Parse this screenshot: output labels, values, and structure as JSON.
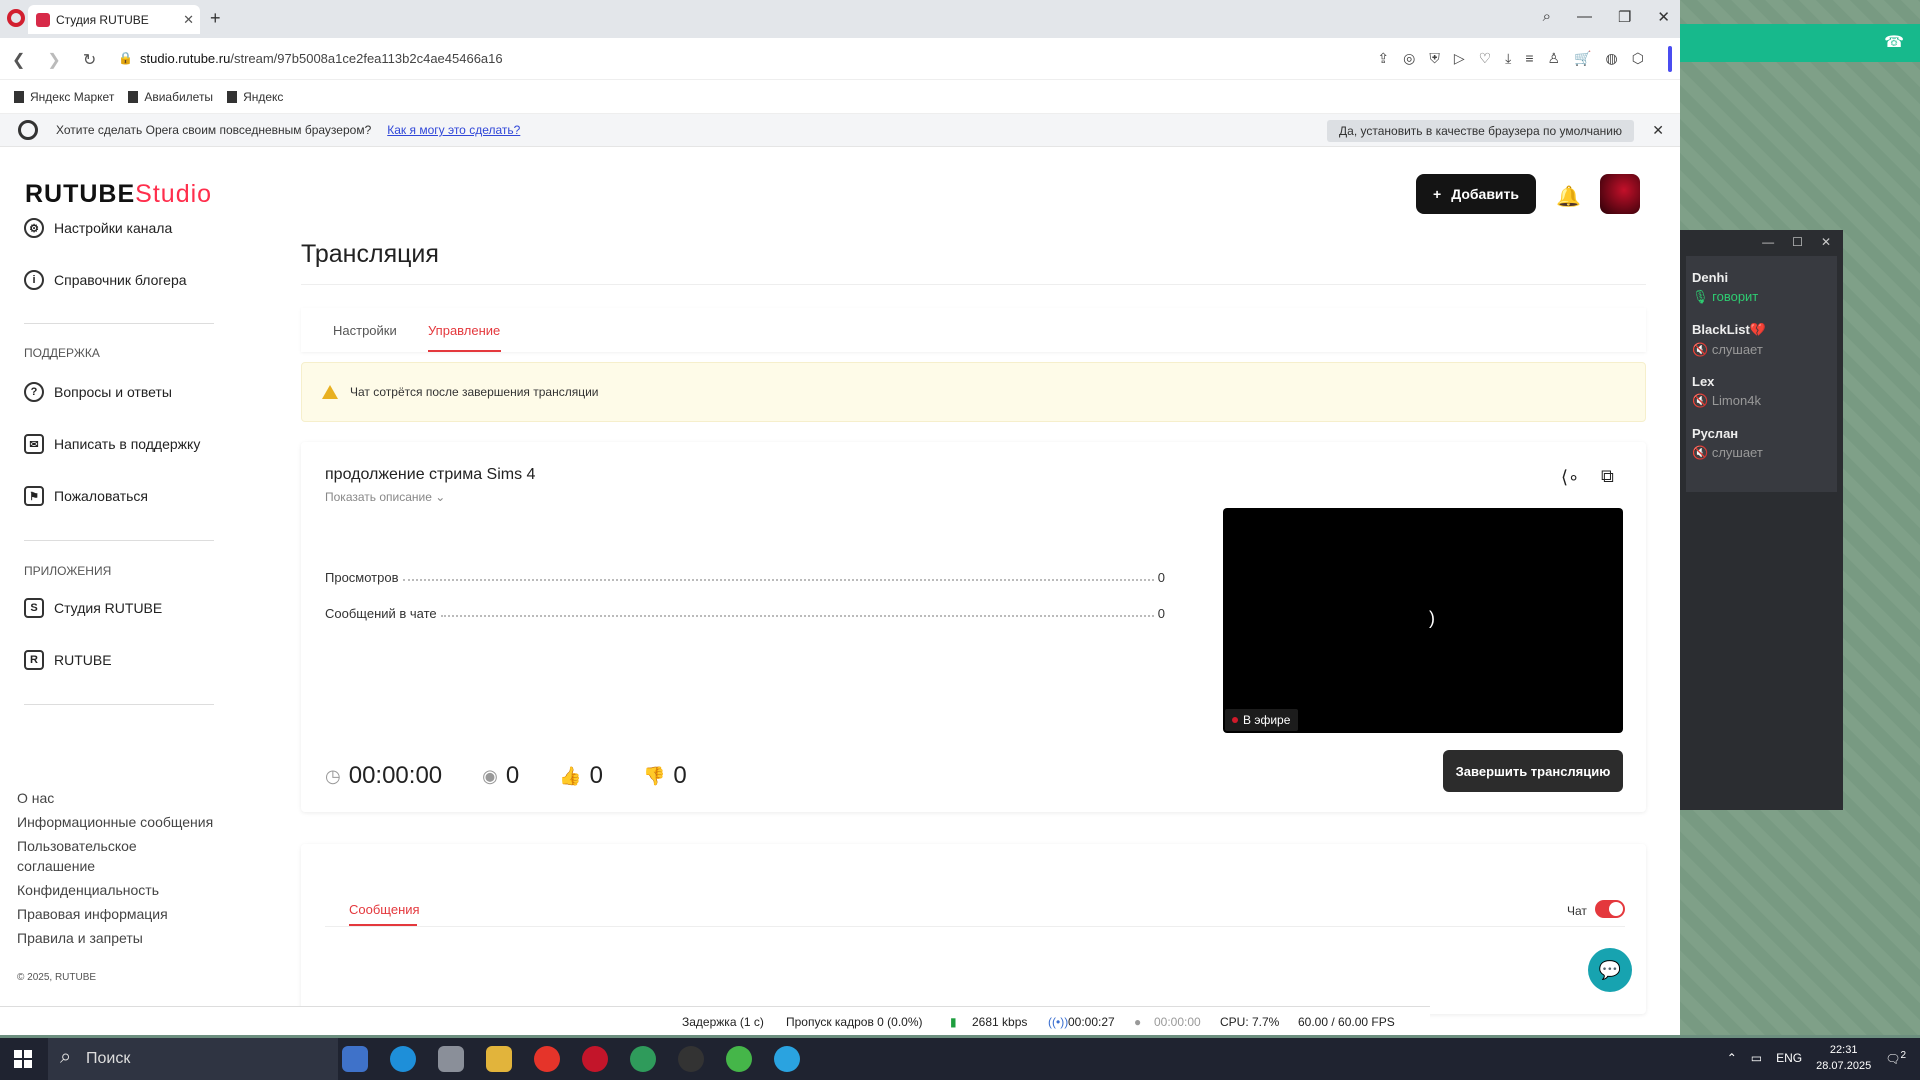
{
  "browser": {
    "tab_title": "Студия RUTUBE",
    "url_host": "studio.rutube.ru",
    "url_path": "/stream/97b5008a1ce2fea113b2c4ae45466a16",
    "bookmarks": [
      "Яндекс Маркет",
      "Авиабилеты",
      "Яндекс"
    ],
    "default_prompt": "Хотите сделать Opera своим повседневным браузером?",
    "default_link": "Как я могу это сделать?",
    "default_button": "Да, установить в качестве браузера по умолчанию"
  },
  "header": {
    "logo_main": "RUTUBE",
    "logo_studio": "Studio",
    "add_button": "Добавить"
  },
  "sidebar": {
    "items": [
      {
        "label": "Настройки канала"
      },
      {
        "label": "Справочник блогера"
      }
    ],
    "support_title": "ПОДДЕРЖКА",
    "support_items": [
      {
        "label": "Вопросы и ответы"
      },
      {
        "label": "Написать в поддержку"
      },
      {
        "label": "Пожаловаться"
      }
    ],
    "apps_title": "ПРИЛОЖЕНИЯ",
    "apps_items": [
      {
        "label": "Студия RUTUBE"
      },
      {
        "label": "RUTUBE"
      }
    ],
    "footer_links": [
      "О нас",
      "Информационные сообщения",
      "Пользовательское соглашение",
      "Конфиденциальность",
      "Правовая информация",
      "Правила и запреты"
    ],
    "copyright": "© 2025, RUTUBE"
  },
  "main": {
    "title": "Трансляция",
    "tabs": [
      {
        "label": "Настройки"
      },
      {
        "label": "Управление"
      }
    ],
    "active_tab": "Управление",
    "warning": "Чат сотрётся после завершения трансляции",
    "stream": {
      "title": "продолжение стрима Sims 4",
      "show_description": "Показать описание",
      "stats": [
        {
          "label": "Просмотров",
          "value": "0"
        },
        {
          "label": "Сообщений в чате",
          "value": "0"
        }
      ],
      "live_badge": "В эфире",
      "player_glyph": ")",
      "duration": "00:00:00",
      "viewers": "0",
      "likes": "0",
      "dislikes": "0",
      "end_button": "Завершить трансляцию"
    },
    "messages_tab": "Сообщения",
    "chat_label": "Чат",
    "chat_enabled": true
  },
  "obs": {
    "delay": "Задержка (1 с)",
    "dropped": "Пропуск кадров 0 (0.0%)",
    "bitrate": "2681 kbps",
    "stream_time": "00:00:27",
    "rec_time": "00:00:00",
    "cpu": "CPU: 7.7%",
    "fps": "60.00 / 60.00 FPS"
  },
  "voice": {
    "users": [
      {
        "name": "Denhi",
        "status": "говорит"
      },
      {
        "name": "BlackList💔",
        "status": "слушает"
      },
      {
        "name": "Lex",
        "status": "Limon4k"
      },
      {
        "name": "Руслан",
        "status": "слушает"
      }
    ]
  },
  "taskbar": {
    "search": "Поиск",
    "lang": "ENG",
    "time": "22:31",
    "date": "28.07.2025",
    "notifications": "2"
  }
}
